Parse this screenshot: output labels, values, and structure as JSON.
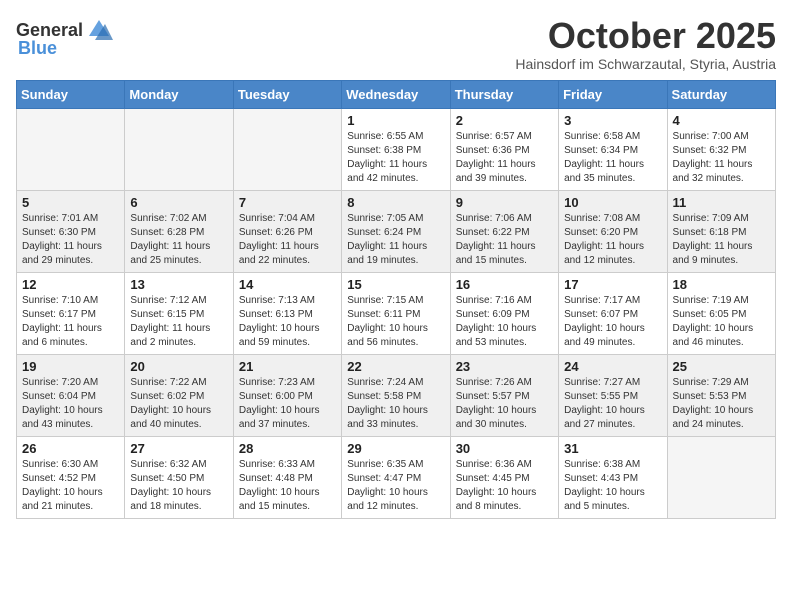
{
  "header": {
    "logo_general": "General",
    "logo_blue": "Blue",
    "month_title": "October 2025",
    "location": "Hainsdorf im Schwarzautal, Styria, Austria"
  },
  "days_of_week": [
    "Sunday",
    "Monday",
    "Tuesday",
    "Wednesday",
    "Thursday",
    "Friday",
    "Saturday"
  ],
  "weeks": [
    [
      {
        "day": "",
        "info": ""
      },
      {
        "day": "",
        "info": ""
      },
      {
        "day": "",
        "info": ""
      },
      {
        "day": "1",
        "info": "Sunrise: 6:55 AM\nSunset: 6:38 PM\nDaylight: 11 hours\nand 42 minutes."
      },
      {
        "day": "2",
        "info": "Sunrise: 6:57 AM\nSunset: 6:36 PM\nDaylight: 11 hours\nand 39 minutes."
      },
      {
        "day": "3",
        "info": "Sunrise: 6:58 AM\nSunset: 6:34 PM\nDaylight: 11 hours\nand 35 minutes."
      },
      {
        "day": "4",
        "info": "Sunrise: 7:00 AM\nSunset: 6:32 PM\nDaylight: 11 hours\nand 32 minutes."
      }
    ],
    [
      {
        "day": "5",
        "info": "Sunrise: 7:01 AM\nSunset: 6:30 PM\nDaylight: 11 hours\nand 29 minutes."
      },
      {
        "day": "6",
        "info": "Sunrise: 7:02 AM\nSunset: 6:28 PM\nDaylight: 11 hours\nand 25 minutes."
      },
      {
        "day": "7",
        "info": "Sunrise: 7:04 AM\nSunset: 6:26 PM\nDaylight: 11 hours\nand 22 minutes."
      },
      {
        "day": "8",
        "info": "Sunrise: 7:05 AM\nSunset: 6:24 PM\nDaylight: 11 hours\nand 19 minutes."
      },
      {
        "day": "9",
        "info": "Sunrise: 7:06 AM\nSunset: 6:22 PM\nDaylight: 11 hours\nand 15 minutes."
      },
      {
        "day": "10",
        "info": "Sunrise: 7:08 AM\nSunset: 6:20 PM\nDaylight: 11 hours\nand 12 minutes."
      },
      {
        "day": "11",
        "info": "Sunrise: 7:09 AM\nSunset: 6:18 PM\nDaylight: 11 hours\nand 9 minutes."
      }
    ],
    [
      {
        "day": "12",
        "info": "Sunrise: 7:10 AM\nSunset: 6:17 PM\nDaylight: 11 hours\nand 6 minutes."
      },
      {
        "day": "13",
        "info": "Sunrise: 7:12 AM\nSunset: 6:15 PM\nDaylight: 11 hours\nand 2 minutes."
      },
      {
        "day": "14",
        "info": "Sunrise: 7:13 AM\nSunset: 6:13 PM\nDaylight: 10 hours\nand 59 minutes."
      },
      {
        "day": "15",
        "info": "Sunrise: 7:15 AM\nSunset: 6:11 PM\nDaylight: 10 hours\nand 56 minutes."
      },
      {
        "day": "16",
        "info": "Sunrise: 7:16 AM\nSunset: 6:09 PM\nDaylight: 10 hours\nand 53 minutes."
      },
      {
        "day": "17",
        "info": "Sunrise: 7:17 AM\nSunset: 6:07 PM\nDaylight: 10 hours\nand 49 minutes."
      },
      {
        "day": "18",
        "info": "Sunrise: 7:19 AM\nSunset: 6:05 PM\nDaylight: 10 hours\nand 46 minutes."
      }
    ],
    [
      {
        "day": "19",
        "info": "Sunrise: 7:20 AM\nSunset: 6:04 PM\nDaylight: 10 hours\nand 43 minutes."
      },
      {
        "day": "20",
        "info": "Sunrise: 7:22 AM\nSunset: 6:02 PM\nDaylight: 10 hours\nand 40 minutes."
      },
      {
        "day": "21",
        "info": "Sunrise: 7:23 AM\nSunset: 6:00 PM\nDaylight: 10 hours\nand 37 minutes."
      },
      {
        "day": "22",
        "info": "Sunrise: 7:24 AM\nSunset: 5:58 PM\nDaylight: 10 hours\nand 33 minutes."
      },
      {
        "day": "23",
        "info": "Sunrise: 7:26 AM\nSunset: 5:57 PM\nDaylight: 10 hours\nand 30 minutes."
      },
      {
        "day": "24",
        "info": "Sunrise: 7:27 AM\nSunset: 5:55 PM\nDaylight: 10 hours\nand 27 minutes."
      },
      {
        "day": "25",
        "info": "Sunrise: 7:29 AM\nSunset: 5:53 PM\nDaylight: 10 hours\nand 24 minutes."
      }
    ],
    [
      {
        "day": "26",
        "info": "Sunrise: 6:30 AM\nSunset: 4:52 PM\nDaylight: 10 hours\nand 21 minutes."
      },
      {
        "day": "27",
        "info": "Sunrise: 6:32 AM\nSunset: 4:50 PM\nDaylight: 10 hours\nand 18 minutes."
      },
      {
        "day": "28",
        "info": "Sunrise: 6:33 AM\nSunset: 4:48 PM\nDaylight: 10 hours\nand 15 minutes."
      },
      {
        "day": "29",
        "info": "Sunrise: 6:35 AM\nSunset: 4:47 PM\nDaylight: 10 hours\nand 12 minutes."
      },
      {
        "day": "30",
        "info": "Sunrise: 6:36 AM\nSunset: 4:45 PM\nDaylight: 10 hours\nand 8 minutes."
      },
      {
        "day": "31",
        "info": "Sunrise: 6:38 AM\nSunset: 4:43 PM\nDaylight: 10 hours\nand 5 minutes."
      },
      {
        "day": "",
        "info": ""
      }
    ]
  ]
}
